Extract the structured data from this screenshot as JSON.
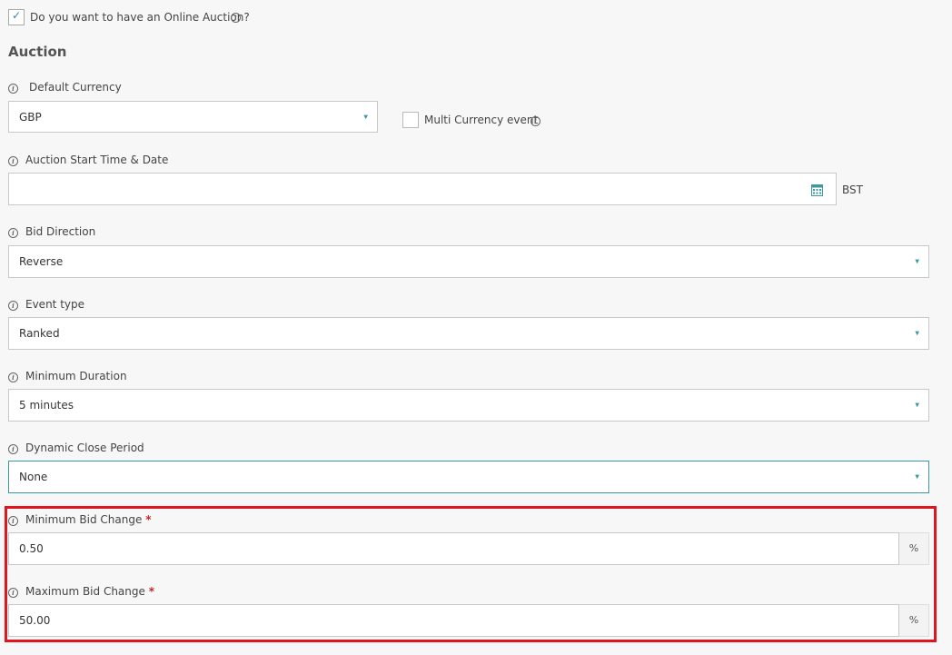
{
  "online_auction": {
    "question": "Do you want to have an Online Auction?",
    "checked": true
  },
  "section_title": "Auction",
  "default_currency": {
    "label": "Default Currency",
    "value": "GBP"
  },
  "multi_currency": {
    "label": "Multi Currency event",
    "checked": false
  },
  "start_time": {
    "label": "Auction Start Time & Date",
    "value": "",
    "timezone": "BST",
    "icon": "calendar-icon"
  },
  "bid_direction": {
    "label": "Bid Direction",
    "value": "Reverse"
  },
  "event_type": {
    "label": "Event type",
    "value": "Ranked"
  },
  "minimum_duration": {
    "label": "Minimum Duration",
    "value": "5 minutes"
  },
  "dynamic_close": {
    "label": "Dynamic Close Period",
    "value": "None"
  },
  "min_bid_change": {
    "label": "Minimum Bid Change",
    "required_mark": "*",
    "value": "0.50",
    "unit": "%"
  },
  "max_bid_change": {
    "label": "Maximum Bid Change",
    "required_mark": "*",
    "value": "50.00",
    "unit": "%"
  },
  "colors": {
    "accent": "#3a9aa0",
    "required": "#c0262d",
    "highlight": "#e0151f",
    "background": "#f7f7f7"
  }
}
